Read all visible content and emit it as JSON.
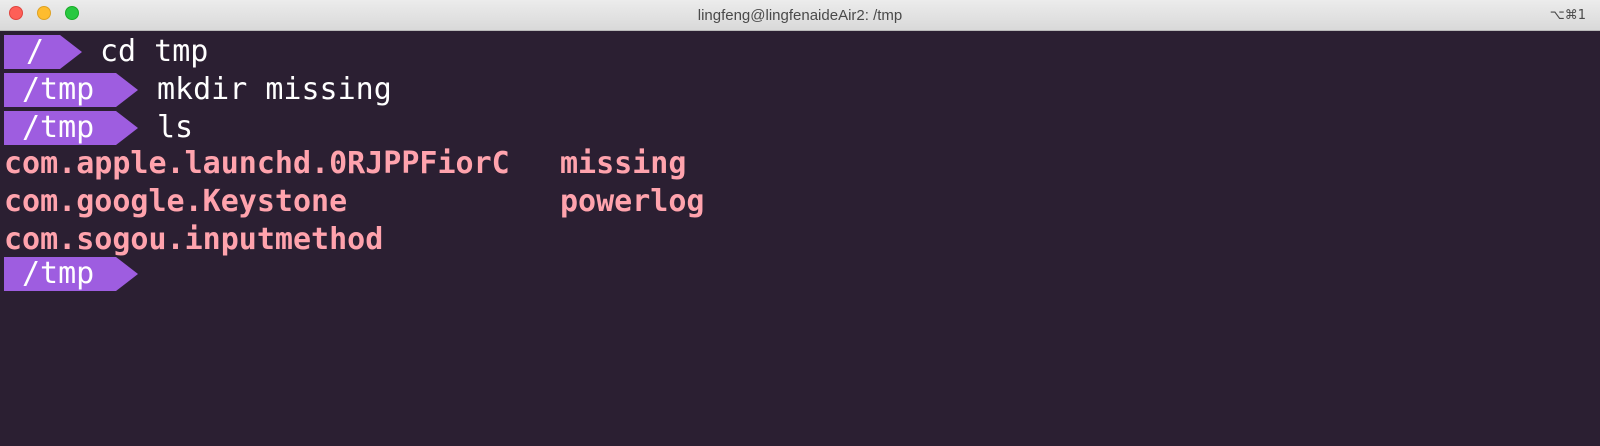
{
  "window": {
    "title": "lingfeng@lingfenaideAir2: /tmp",
    "shortcut": "⌥⌘1"
  },
  "terminal": {
    "lines": [
      {
        "dir": "/",
        "command": "cd tmp"
      },
      {
        "dir": "/tmp",
        "command": "mkdir missing"
      },
      {
        "dir": "/tmp",
        "command": "ls"
      }
    ],
    "ls_output": {
      "col1": [
        "com.apple.launchd.0RJPPFiorC",
        "com.google.Keystone",
        "com.sogou.inputmethod"
      ],
      "col2": [
        "missing",
        "powerlog"
      ]
    },
    "current_prompt": {
      "dir": "/tmp"
    }
  },
  "colors": {
    "background": "#2b1f32",
    "prompt_bg": "#9e5de0",
    "output_text": "#ffa3ad"
  }
}
